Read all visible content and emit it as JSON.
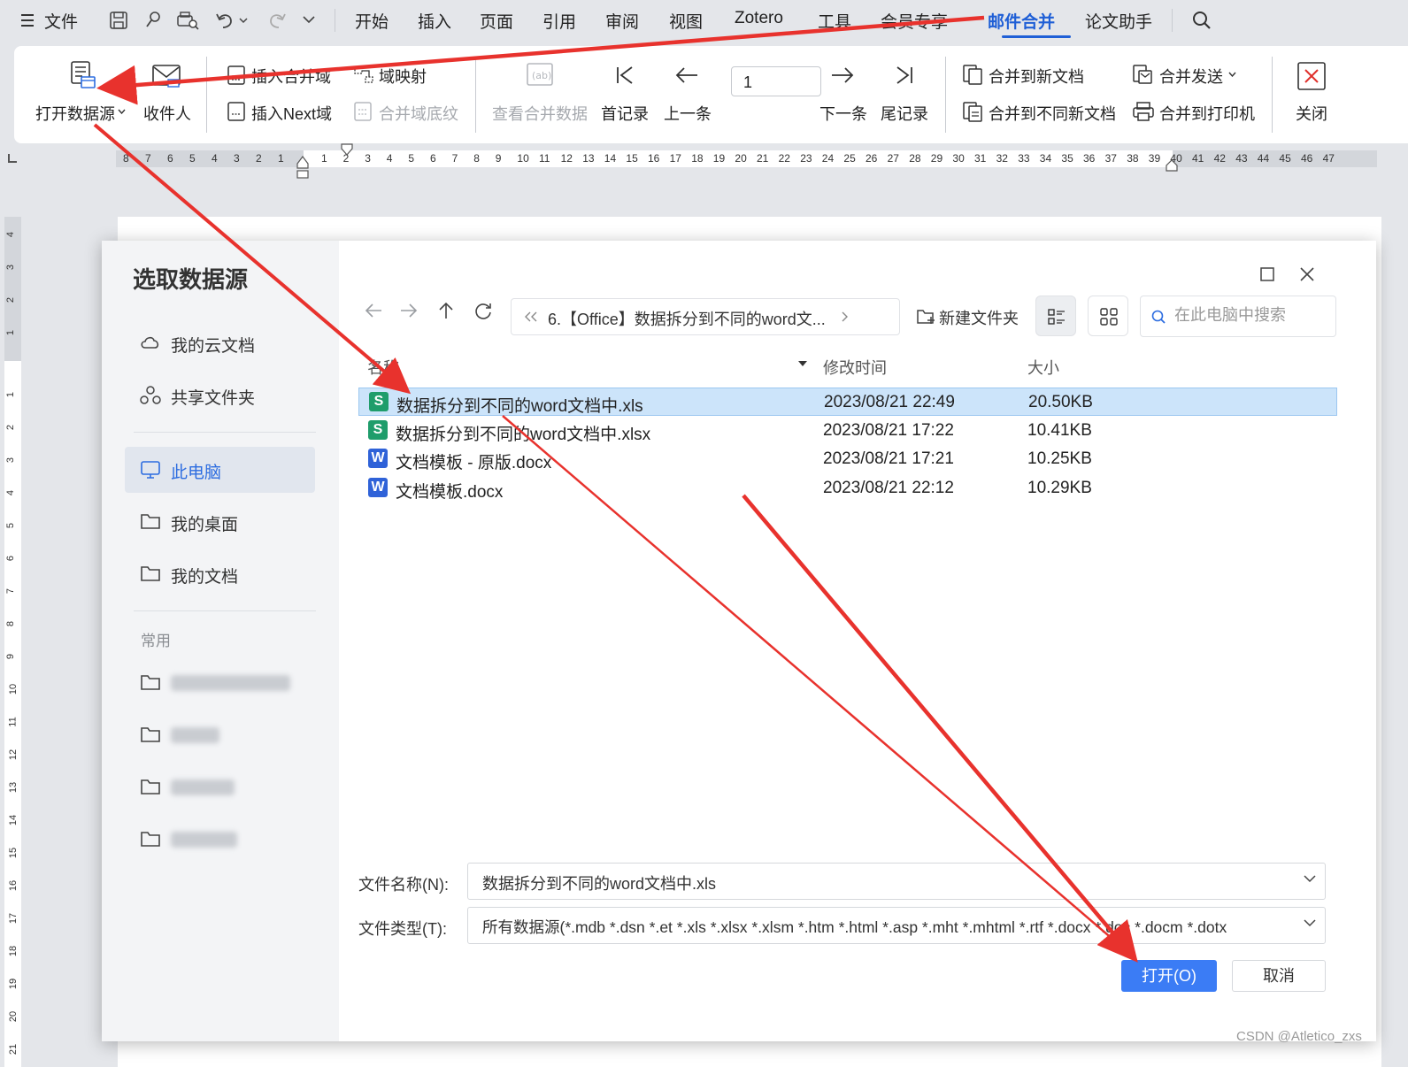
{
  "menubar": {
    "file": "文件",
    "tabs": [
      "开始",
      "插入",
      "页面",
      "引用",
      "审阅",
      "视图",
      "Zotero",
      "工具",
      "会员专享",
      "邮件合并",
      "论文助手"
    ],
    "active_tab": "邮件合并"
  },
  "ribbon": {
    "open_datasource": "打开数据源",
    "recipients": "收件人",
    "insert_merge_field": "插入合并域",
    "field_mapping": "域映射",
    "insert_next": "插入Next域",
    "merge_field_shading": "合并域底纹",
    "view_merged_data": "查看合并数据",
    "first_record": "首记录",
    "prev_record": "上一条",
    "record_number": "1",
    "next_record": "下一条",
    "last_record": "尾记录",
    "merge_new_doc": "合并到新文档",
    "merge_send": "合并发送",
    "merge_diff_docs": "合并到不同新文档",
    "merge_printer": "合并到打印机",
    "close": "关闭"
  },
  "ruler": {
    "left_numbers": [
      "8",
      "7",
      "6",
      "5",
      "4",
      "3",
      "2",
      "1"
    ],
    "right_numbers": [
      "1",
      "2",
      "3",
      "4",
      "5",
      "6",
      "7",
      "8",
      "9",
      "10",
      "11",
      "12",
      "13",
      "14",
      "15",
      "16",
      "17",
      "18",
      "19",
      "20",
      "21",
      "22",
      "23",
      "24",
      "25",
      "26",
      "27",
      "28",
      "29",
      "30",
      "31",
      "32",
      "33",
      "34",
      "35",
      "36",
      "37",
      "38",
      "39",
      "40",
      "41",
      "42",
      "43",
      "44",
      "45",
      "46",
      "47"
    ],
    "vertical_top": [
      "4",
      "3",
      "2",
      "1"
    ],
    "vertical_numbers": [
      "1",
      "2",
      "3",
      "4",
      "5",
      "6",
      "7",
      "8",
      "9",
      "10",
      "11",
      "12",
      "13",
      "14",
      "15",
      "16",
      "17",
      "18",
      "19",
      "20",
      "21"
    ]
  },
  "dialog": {
    "title": "选取数据源",
    "sidebar": {
      "cloud": "我的云文档",
      "shared": "共享文件夹",
      "this_pc": "此电脑",
      "desktop": "我的桌面",
      "documents": "我的文档",
      "frequent": "常用"
    },
    "path": "6.【Office】数据拆分到不同的word文...",
    "new_folder": "新建文件夹",
    "search_placeholder": "在此电脑中搜索",
    "columns": {
      "name": "名称",
      "modified": "修改时间",
      "size": "大小"
    },
    "files": [
      {
        "type": "S",
        "name": "数据拆分到不同的word文档中.xls",
        "modified": "2023/08/21 22:49",
        "size": "20.50KB",
        "selected": true
      },
      {
        "type": "S",
        "name": "数据拆分到不同的word文档中.xlsx",
        "modified": "2023/08/21 17:22",
        "size": "10.41KB",
        "selected": false
      },
      {
        "type": "W",
        "name": "文档模板 - 原版.docx",
        "modified": "2023/08/21 17:21",
        "size": "10.25KB",
        "selected": false
      },
      {
        "type": "W",
        "name": "文档模板.docx",
        "modified": "2023/08/21 22:12",
        "size": "10.29KB",
        "selected": false
      }
    ],
    "filename_label": "文件名称(N):",
    "filename_value": "数据拆分到不同的word文档中.xls",
    "filetype_label": "文件类型(T):",
    "filetype_value": "所有数据源(*.mdb *.dsn *.et *.xls *.xlsx *.xlsm *.htm *.html *.asp *.mht *.mhtml *.rtf *.docx *.doc *.docm *.dotx",
    "open_button": "打开(O)",
    "cancel_button": "取消"
  },
  "colors": {
    "accent": "#1f5fd6",
    "primary_button": "#3b7cf5",
    "selected_row": "#cce4fa",
    "annotation_arrow": "#e8322d",
    "sheet_icon": "#1f9d6b",
    "word_icon": "#2f62d8"
  },
  "watermark": "CSDN @Atletico_zxs"
}
